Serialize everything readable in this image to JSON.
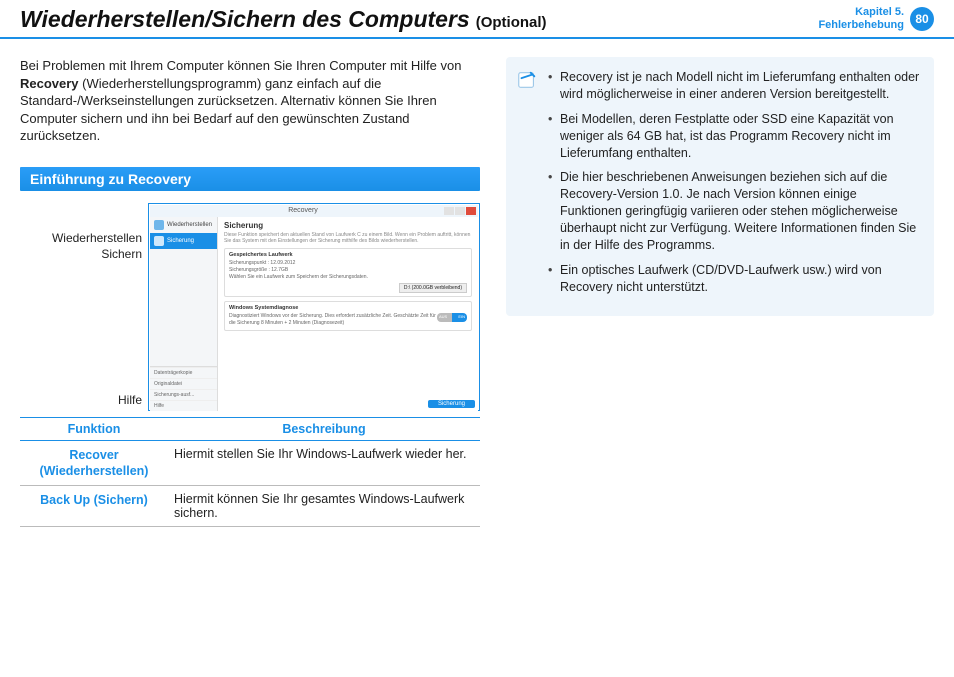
{
  "header": {
    "title": "Wiederherstellen/Sichern des Computers",
    "subtitle": "(Optional)",
    "chapter_line1": "Kapitel 5.",
    "chapter_line2": "Fehlerbehebung",
    "page_number": "80"
  },
  "left": {
    "intro_before_bold": "Bei Problemen mit Ihrem Computer können Sie Ihren Computer mit Hilfe von ",
    "intro_bold": "Recovery",
    "intro_after_bold": " (Wiederherstellungsprogramm) ganz einfach auf die Standard-/Werkseinstellungen zurücksetzen. Alternativ können Sie Ihren Computer sichern und ihn bei Bedarf auf den gewünschten Zustand zurücksetzen.",
    "section_heading": "Einführung zu Recovery",
    "callouts": {
      "restore": "Wiederherstellen",
      "backup": "Sichern",
      "help": "Hilfe"
    },
    "screenshot": {
      "window_title": "Recovery",
      "side_restore": "Wiederherstellen",
      "side_backup": "Sicherung",
      "side_bottom_1": "Datenträgerkopie",
      "side_bottom_2": "Originaldatei",
      "side_bottom_3": "Sicherungs-ausf...",
      "side_bottom_4": "Hilfe",
      "main_title": "Sicherung",
      "main_desc": "Diese Funktion speichert den aktuellen Stand von Laufwerk C zu einem Bild. Wenn ein Problem auftritt, können Sie das System mit den Einstellungen der Sicherung mithilfe des Bilds wiederherstellen.",
      "panel1_title": "Gespeichertes Laufwerk",
      "panel1_line1": "Sicherungspunkt : 12.09.2012",
      "panel1_line2": "Sicherungsgröße : 12.7GB",
      "panel1_line3": "Wählen Sie ein Laufwerk zum Speichern der Sicherungsdaten.",
      "panel1_drive": "D:\\ (200.0GB verbleibend)",
      "panel2_title": "Windows Systemdiagnose",
      "panel2_text": "Diagnostiziert Windows vor der Sicherung. Dies erfordert zusätzliche Zeit. Geschätzte Zeit für die Sicherung 8 Minuten + 2 Minuten (Diagnosezeit)",
      "toggle_off": "AUS",
      "toggle_on": "EIN",
      "primary_button": "Sicherung"
    },
    "table": {
      "col1_header": "Funktion",
      "col2_header": "Beschreibung",
      "rows": [
        {
          "fn": "Recover (Wiederherstellen)",
          "desc": "Hiermit stellen Sie Ihr Windows-Laufwerk wieder her."
        },
        {
          "fn": "Back Up (Sichern)",
          "desc": "Hiermit können Sie Ihr gesamtes Windows-Laufwerk sichern."
        }
      ]
    }
  },
  "right": {
    "notes": [
      "Recovery ist je nach Modell nicht im Lieferumfang enthalten oder wird möglicherweise in einer anderen Version bereitgestellt.",
      "Bei Modellen, deren Festplatte oder SSD eine Kapazität von weniger als 64 GB hat, ist das Programm Recovery nicht im Lieferumfang enthalten.",
      "Die hier beschriebenen Anweisungen beziehen sich auf die Recovery-Version 1.0. Je nach Version können einige Funktionen geringfügig variieren oder stehen möglicherweise überhaupt nicht zur Verfügung. Weitere Informationen finden Sie in der Hilfe des Programms.",
      "Ein optisches Laufwerk (CD/DVD-Laufwerk usw.) wird von Recovery nicht unterstützt."
    ]
  }
}
